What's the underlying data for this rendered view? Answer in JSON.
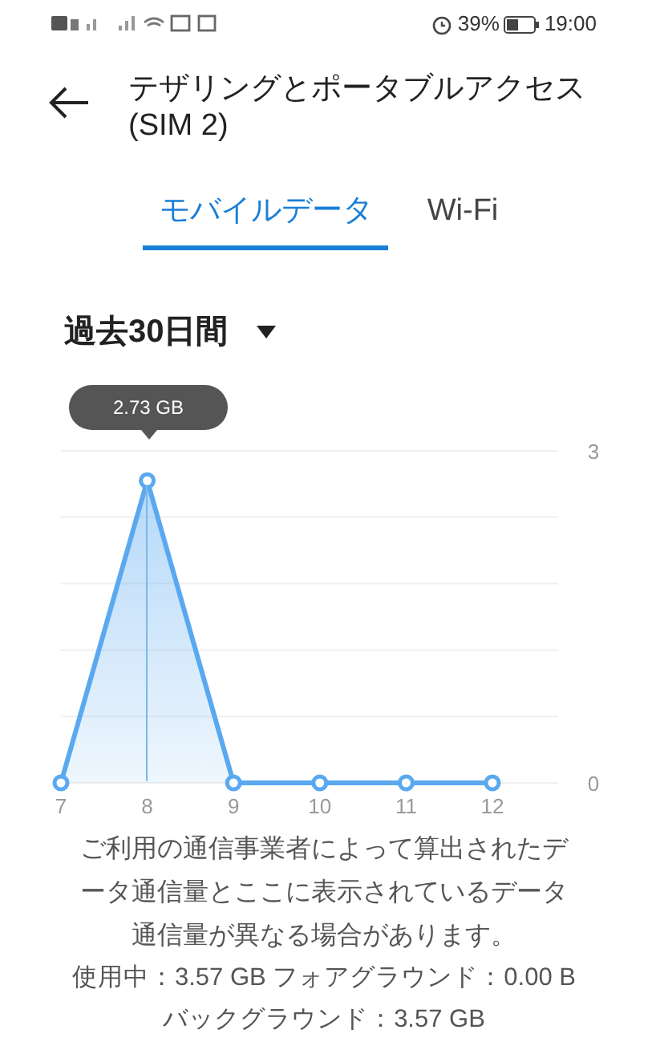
{
  "status_bar": {
    "battery": "39%",
    "time": "19:00"
  },
  "header": {
    "title": "テザリングとポータブルアクセス (SIM 2)"
  },
  "tabs": [
    {
      "label": "モバイルデータ",
      "selected": true
    },
    {
      "label": "Wi-Fi",
      "selected": false
    }
  ],
  "period_dropdown": {
    "value": "過去30日間"
  },
  "chart_data": {
    "type": "area",
    "categories": [
      "7",
      "8",
      "9",
      "10",
      "11",
      "12"
    ],
    "series": [
      {
        "color": "#5aa9f0",
        "values": [
          0,
          2.73,
          0,
          0,
          0,
          0
        ]
      }
    ],
    "ylim": [
      0,
      3
    ],
    "yticks": [
      0,
      3
    ]
  },
  "tooltip": "2.73 GB",
  "notice": "ご利用の通信事業者によって算出されたデータ通信量とここに表示されているデータ通信量が異なる場合があります。",
  "usage_lines": [
    "使用中：3.57 GB フォアグラウンド：0.00 B",
    "バックグラウンド：3.57 GB"
  ]
}
